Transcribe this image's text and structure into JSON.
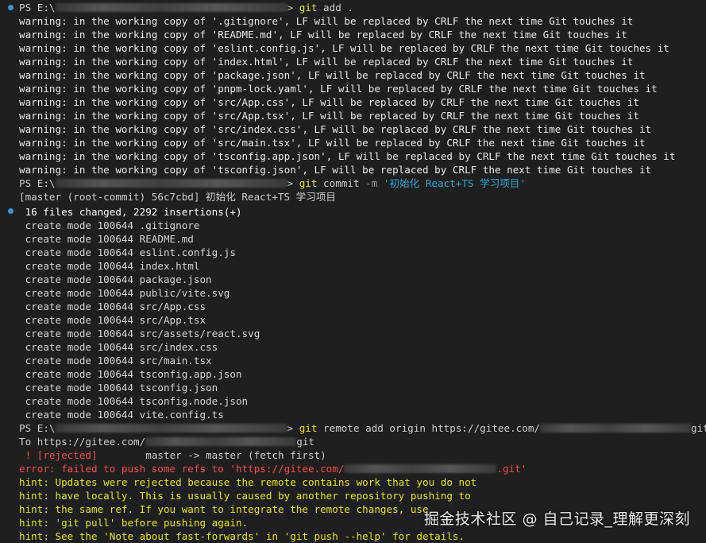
{
  "prompt": {
    "ps": "PS E:\\",
    "arrow": ">"
  },
  "cmd1": {
    "name": "git",
    "args": "add ."
  },
  "warnings": [
    "warning: in the working copy of '.gitignore', LF will be replaced by CRLF the next time Git touches it",
    "warning: in the working copy of 'README.md', LF will be replaced by CRLF the next time Git touches it",
    "warning: in the working copy of 'eslint.config.js', LF will be replaced by CRLF the next time Git touches it",
    "warning: in the working copy of 'index.html', LF will be replaced by CRLF the next time Git touches it",
    "warning: in the working copy of 'package.json', LF will be replaced by CRLF the next time Git touches it",
    "warning: in the working copy of 'pnpm-lock.yaml', LF will be replaced by CRLF the next time Git touches it",
    "warning: in the working copy of 'src/App.css', LF will be replaced by CRLF the next time Git touches it",
    "warning: in the working copy of 'src/App.tsx', LF will be replaced by CRLF the next time Git touches it",
    "warning: in the working copy of 'src/index.css', LF will be replaced by CRLF the next time Git touches it",
    "warning: in the working copy of 'src/main.tsx', LF will be replaced by CRLF the next time Git touches it",
    "warning: in the working copy of 'tsconfig.app.json', LF will be replaced by CRLF the next time Git touches it",
    "warning: in the working copy of 'tsconfig.json', LF will be replaced by CRLF the next time Git touches it"
  ],
  "cmd2": {
    "name": "git",
    "args": "commit",
    "flag": "-m",
    "message": "'初始化 React+TS 学习项目'"
  },
  "commit_summary": "[master (root-commit) 56c7cbd] 初始化 React+TS 学习项目",
  "files_changed": " 16 files changed, 2292 insertions(+)",
  "creates": [
    " create mode 100644 .gitignore",
    " create mode 100644 README.md",
    " create mode 100644 eslint.config.js",
    " create mode 100644 index.html",
    " create mode 100644 package.json",
    " create mode 100644 public/vite.svg",
    " create mode 100644 src/App.css",
    " create mode 100644 src/App.tsx",
    " create mode 100644 src/assets/react.svg",
    " create mode 100644 src/index.css",
    " create mode 100644 src/main.tsx",
    " create mode 100644 tsconfig.app.json",
    " create mode 100644 tsconfig.json",
    " create mode 100644 tsconfig.node.json",
    " create mode 100644 vite.config.ts"
  ],
  "cmd3": {
    "name": "git",
    "args_before": "remote add origin https://gitee.com/",
    "args_after": "git"
  },
  "push_to": {
    "prefix": "To https://gitee.com/",
    "suffix": "git"
  },
  "rejected": {
    "tag": " ! [rejected]",
    "detail": "        master -> master (fetch first)"
  },
  "error": {
    "prefix": "error: failed to push some refs to 'https://gitee.com/",
    "suffix": ".git'"
  },
  "hints": [
    "hint: Updates were rejected because the remote contains work that you do not",
    "hint: have locally. This is usually caused by another repository pushing to",
    "hint: the same ref. If you want to integrate the remote changes, use",
    "hint: 'git pull' before pushing again.",
    "hint: See the 'Note about fast-forwards' in 'git push --help' for details."
  ],
  "watermark": "掘金技术社区 @ 自己记录_理解更深刻",
  "colors": {
    "background": "#1f1f1f",
    "command": "#e5e510",
    "string": "#2aa7d6",
    "error": "#f14c4c",
    "dot": "#3b94d9"
  }
}
